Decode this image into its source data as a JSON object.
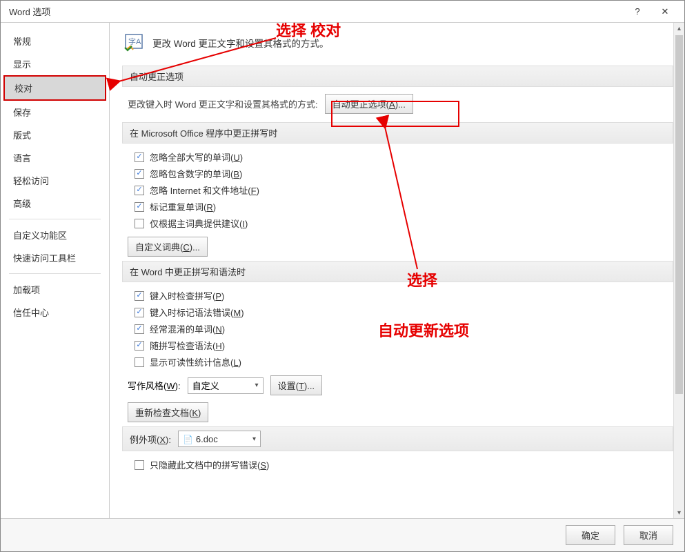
{
  "title": "Word 选项",
  "sidebar": {
    "items": [
      {
        "label": "常规",
        "selected": false
      },
      {
        "label": "显示",
        "selected": false
      },
      {
        "label": "校对",
        "selected": true
      },
      {
        "label": "保存",
        "selected": false
      },
      {
        "label": "版式",
        "selected": false
      },
      {
        "label": "语言",
        "selected": false
      },
      {
        "label": "轻松访问",
        "selected": false
      },
      {
        "label": "高级",
        "selected": false
      },
      {
        "label": "自定义功能区",
        "selected": false
      },
      {
        "label": "快速访问工具栏",
        "selected": false
      },
      {
        "label": "加载项",
        "selected": false
      },
      {
        "label": "信任中心",
        "selected": false
      }
    ]
  },
  "header_text": "更改 Word 更正文字和设置其格式的方式。",
  "sections": {
    "autocorrect": {
      "title": "自动更正选项",
      "explain": "更改键入时 Word 更正文字和设置其格式的方式:",
      "button": "自动更正选项(A)..."
    },
    "mso_spelling": {
      "title": "在 Microsoft Office 程序中更正拼写时",
      "checks": [
        {
          "label": "忽略全部大写的单词(U)",
          "checked": true
        },
        {
          "label": "忽略包含数字的单词(B)",
          "checked": true
        },
        {
          "label": "忽略 Internet 和文件地址(F)",
          "checked": true
        },
        {
          "label": "标记重复单词(R)",
          "checked": true
        },
        {
          "label": "仅根据主词典提供建议(I)",
          "checked": false
        }
      ],
      "dict_button": "自定义词典(C)..."
    },
    "word_proofing": {
      "title": "在 Word 中更正拼写和语法时",
      "checks": [
        {
          "label": "键入时检查拼写(P)",
          "checked": true
        },
        {
          "label": "键入时标记语法错误(M)",
          "checked": true
        },
        {
          "label": "经常混淆的单词(N)",
          "checked": true
        },
        {
          "label": "随拼写检查语法(H)",
          "checked": true
        },
        {
          "label": "显示可读性统计信息(L)",
          "checked": false
        }
      ],
      "style_label": "写作风格(W):",
      "style_value": "自定义",
      "settings_btn": "设置(T)...",
      "recheck_btn": "重新检查文档(K)"
    },
    "exceptions": {
      "title": "例外项(X):",
      "value": "6.doc",
      "checks": [
        {
          "label": "只隐藏此文档中的拼写错误(S)",
          "checked": false
        }
      ]
    }
  },
  "footer": {
    "ok": "确定",
    "cancel": "取消"
  },
  "annotations": {
    "top_label": "选择  校对",
    "right_label_1": "选择",
    "right_label_2": "自动更新选项"
  }
}
